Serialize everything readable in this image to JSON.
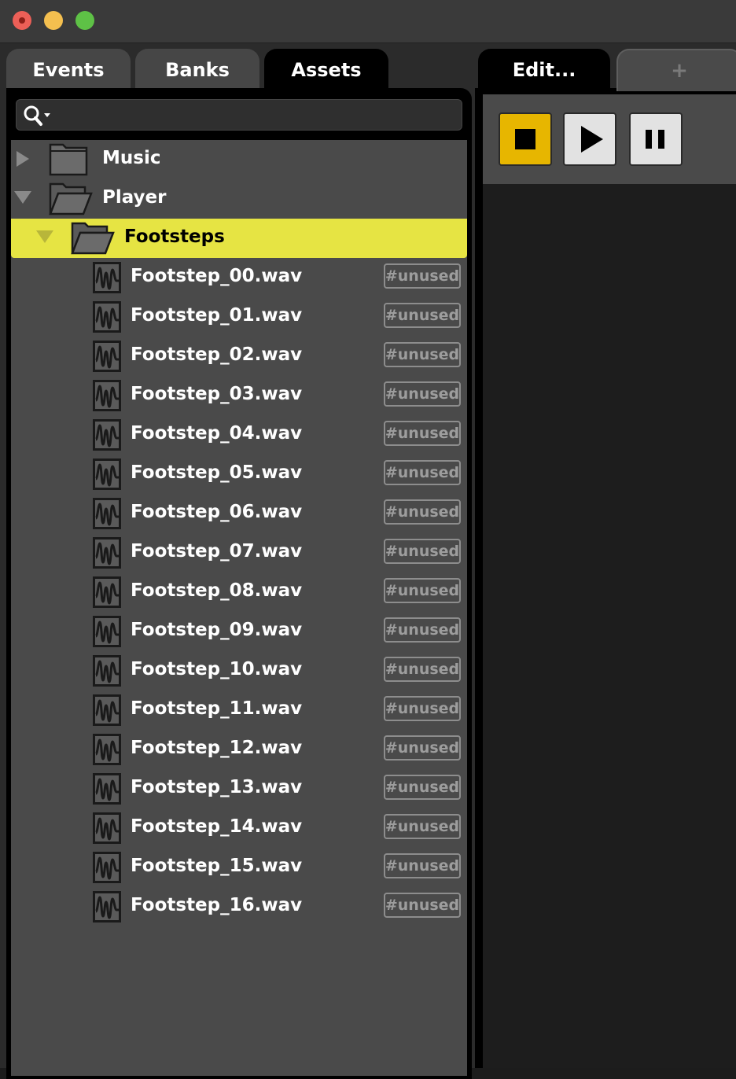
{
  "tabs": {
    "events": "Events",
    "banks": "Banks",
    "assets": "Assets",
    "edit": "Edit...",
    "add": "+"
  },
  "search": {
    "value": "",
    "placeholder": ""
  },
  "tree": {
    "music": "Music",
    "player": "Player",
    "footsteps": "Footsteps"
  },
  "files": [
    {
      "name": "Footstep_00.wav",
      "tag": "#unused"
    },
    {
      "name": "Footstep_01.wav",
      "tag": "#unused"
    },
    {
      "name": "Footstep_02.wav",
      "tag": "#unused"
    },
    {
      "name": "Footstep_03.wav",
      "tag": "#unused"
    },
    {
      "name": "Footstep_04.wav",
      "tag": "#unused"
    },
    {
      "name": "Footstep_05.wav",
      "tag": "#unused"
    },
    {
      "name": "Footstep_06.wav",
      "tag": "#unused"
    },
    {
      "name": "Footstep_07.wav",
      "tag": "#unused"
    },
    {
      "name": "Footstep_08.wav",
      "tag": "#unused"
    },
    {
      "name": "Footstep_09.wav",
      "tag": "#unused"
    },
    {
      "name": "Footstep_10.wav",
      "tag": "#unused"
    },
    {
      "name": "Footstep_11.wav",
      "tag": "#unused"
    },
    {
      "name": "Footstep_12.wav",
      "tag": "#unused"
    },
    {
      "name": "Footstep_13.wav",
      "tag": "#unused"
    },
    {
      "name": "Footstep_14.wav",
      "tag": "#unused"
    },
    {
      "name": "Footstep_15.wav",
      "tag": "#unused"
    },
    {
      "name": "Footstep_16.wav",
      "tag": "#unused"
    }
  ],
  "colors": {
    "selection": "#e6e443",
    "stop_button": "#e7b600",
    "panel": "#4a4a4a"
  },
  "icons": {
    "window_close": "close-icon",
    "window_minimize": "minimize-icon",
    "window_zoom": "zoom-icon",
    "search": "search-icon",
    "folder": "folder-icon",
    "open_folder": "folder-open-icon",
    "audio_file": "waveform-icon",
    "stop": "stop-icon",
    "play": "play-icon",
    "pause": "pause-icon"
  }
}
